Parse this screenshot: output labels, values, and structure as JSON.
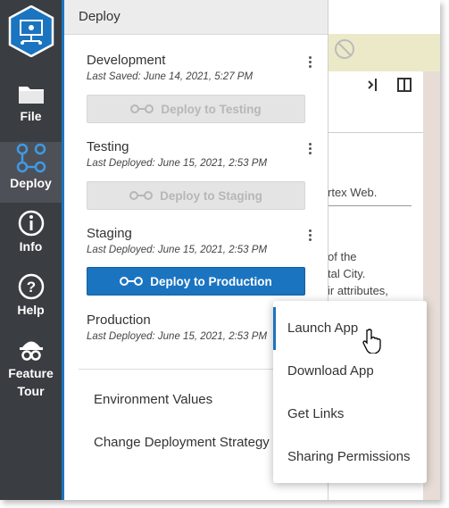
{
  "nav": {
    "items": [
      {
        "id": "file",
        "label": "File",
        "icon": "folder-icon"
      },
      {
        "id": "deploy",
        "label": "Deploy",
        "icon": "deploy-icon"
      },
      {
        "id": "info",
        "label": "Info",
        "icon": "info-icon"
      },
      {
        "id": "help",
        "label": "Help",
        "icon": "help-icon"
      },
      {
        "id": "tour",
        "label": "Feature Tour",
        "icon": "explorer-icon"
      }
    ]
  },
  "panel": {
    "title": "Deploy",
    "environments": [
      {
        "name": "Development",
        "meta": "Last Saved: June 14, 2021, 5:27 PM",
        "button": "Deploy to Testing",
        "button_enabled": false
      },
      {
        "name": "Testing",
        "meta": "Last Deployed: June 15, 2021, 2:53 PM",
        "button": "Deploy to Staging",
        "button_enabled": false
      },
      {
        "name": "Staging",
        "meta": "Last Deployed: June 15, 2021, 2:53 PM",
        "button": "Deploy to Production",
        "button_enabled": true
      },
      {
        "name": "Production",
        "meta": "Last Deployed: June 15, 2021, 2:53 PM"
      }
    ],
    "links": {
      "environment_values": "Environment Values",
      "change_strategy": "Change Deployment Strategy"
    }
  },
  "menu": {
    "items": [
      "Launch App",
      "Download App",
      "Get Links",
      "Sharing Permissions"
    ]
  },
  "background": {
    "text1": "rtex Web.",
    "text2": "of the",
    "text3": "tal City.",
    "text4": "ir attributes,"
  },
  "colors": {
    "rail": "#3a3d41",
    "accent": "#1b74c0",
    "panel_header": "#ececec"
  }
}
